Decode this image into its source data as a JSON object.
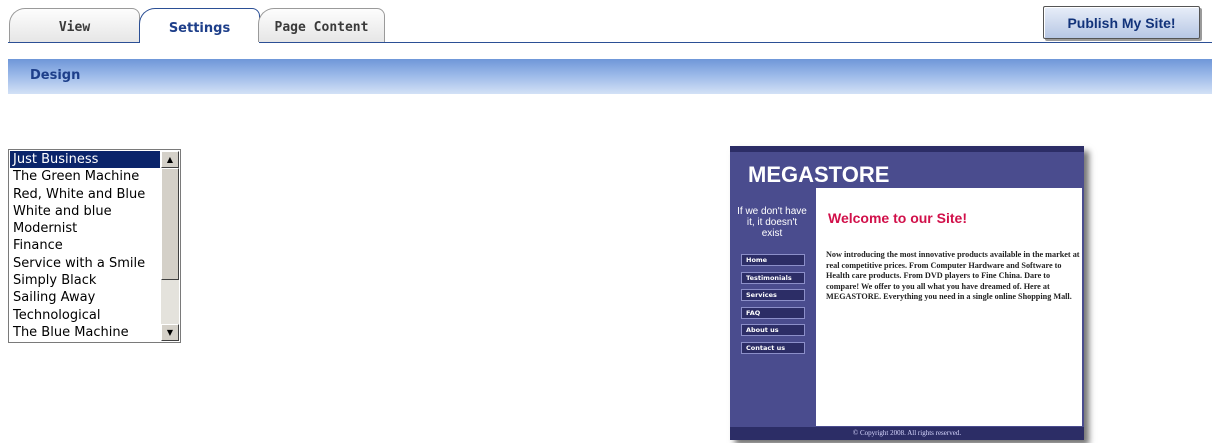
{
  "tabs": [
    {
      "label": "View",
      "active": false
    },
    {
      "label": "Settings",
      "active": true
    },
    {
      "label": "Page Content",
      "active": false
    }
  ],
  "publish_button": "Publish My Site!",
  "section_title": "Design",
  "theme_list": {
    "selected": "Just Business",
    "items": [
      "Just Business",
      "The Green Machine",
      "Red, White and Blue",
      "White and blue",
      "Modernist",
      "Finance",
      "Service with a Smile",
      "Simply Black",
      "Sailing Away",
      "Technological",
      "The Blue Machine"
    ]
  },
  "preview": {
    "site_title": "MEGASTORE",
    "tagline": "If we don't have it, it doesn't exist",
    "nav": [
      "Home",
      "Testimonials",
      "Services",
      "FAQ",
      "About us",
      "Contact us"
    ],
    "welcome": "Welcome to our Site!",
    "body_text": "Now introducing the most innovative products available in the market at real competitive prices. From Computer Hardware and Software to Health care products. From DVD players to Fine China. Dare to compare! We offer to you all what you have dreamed of. Here at MEGASTORE. Everything you need in a single online Shopping Mall.",
    "footer": "© Copyright 2008. All rights reserved."
  },
  "colors": {
    "accent": "#1e3f8a",
    "selection": "#0a246a",
    "preview_bg": "#4a4c8e",
    "preview_dark": "#2c2d66",
    "welcome_red": "#d1104a"
  }
}
